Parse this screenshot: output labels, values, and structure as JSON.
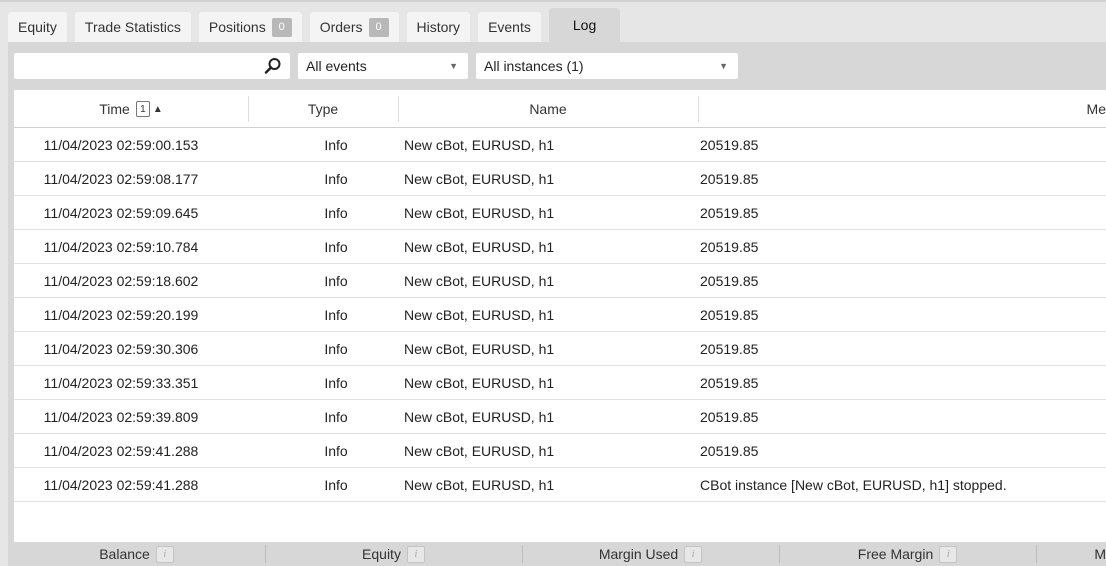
{
  "tabs": [
    {
      "label": "Equity",
      "badge": null,
      "active": false
    },
    {
      "label": "Trade Statistics",
      "badge": null,
      "active": false
    },
    {
      "label": "Positions",
      "badge": "0",
      "active": false
    },
    {
      "label": "Orders",
      "badge": "0",
      "active": false
    },
    {
      "label": "History",
      "badge": null,
      "active": false
    },
    {
      "label": "Events",
      "badge": null,
      "active": false
    },
    {
      "label": "Log",
      "badge": null,
      "active": true
    }
  ],
  "filters": {
    "search_value": "",
    "search_placeholder": "",
    "events_selected": "All events",
    "instances_selected": "All instances (1)"
  },
  "table": {
    "columns": {
      "time": "Time",
      "time_sort_index": "1",
      "type": "Type",
      "name": "Name",
      "message": "Me"
    },
    "rows": [
      {
        "time": "11/04/2023 02:59:00.153",
        "type": "Info",
        "name": "New cBot, EURUSD, h1",
        "message": "20519.85"
      },
      {
        "time": "11/04/2023 02:59:08.177",
        "type": "Info",
        "name": "New cBot, EURUSD, h1",
        "message": "20519.85"
      },
      {
        "time": "11/04/2023 02:59:09.645",
        "type": "Info",
        "name": "New cBot, EURUSD, h1",
        "message": "20519.85"
      },
      {
        "time": "11/04/2023 02:59:10.784",
        "type": "Info",
        "name": "New cBot, EURUSD, h1",
        "message": "20519.85"
      },
      {
        "time": "11/04/2023 02:59:18.602",
        "type": "Info",
        "name": "New cBot, EURUSD, h1",
        "message": "20519.85"
      },
      {
        "time": "11/04/2023 02:59:20.199",
        "type": "Info",
        "name": "New cBot, EURUSD, h1",
        "message": "20519.85"
      },
      {
        "time": "11/04/2023 02:59:30.306",
        "type": "Info",
        "name": "New cBot, EURUSD, h1",
        "message": "20519.85"
      },
      {
        "time": "11/04/2023 02:59:33.351",
        "type": "Info",
        "name": "New cBot, EURUSD, h1",
        "message": "20519.85"
      },
      {
        "time": "11/04/2023 02:59:39.809",
        "type": "Info",
        "name": "New cBot, EURUSD, h1",
        "message": "20519.85"
      },
      {
        "time": "11/04/2023 02:59:41.288",
        "type": "Info",
        "name": "New cBot, EURUSD, h1",
        "message": "20519.85"
      },
      {
        "time": "11/04/2023 02:59:41.288",
        "type": "Info",
        "name": "New cBot, EURUSD, h1",
        "message": "CBot instance [New cBot, EURUSD, h1] stopped."
      }
    ]
  },
  "footer": {
    "balance": "Balance",
    "equity": "Equity",
    "margin_used": "Margin Used",
    "free_margin": "Free Margin",
    "cut_label": "M",
    "info_glyph": "i"
  },
  "icons": {
    "search": "search-icon",
    "chevron": "chevron-down-icon",
    "sort": "sort-ascending-icon",
    "info": "info-icon"
  },
  "colors": {
    "panel": "#d7d7d7",
    "background": "#e6e6e6",
    "badge": "#b8b8b8"
  }
}
